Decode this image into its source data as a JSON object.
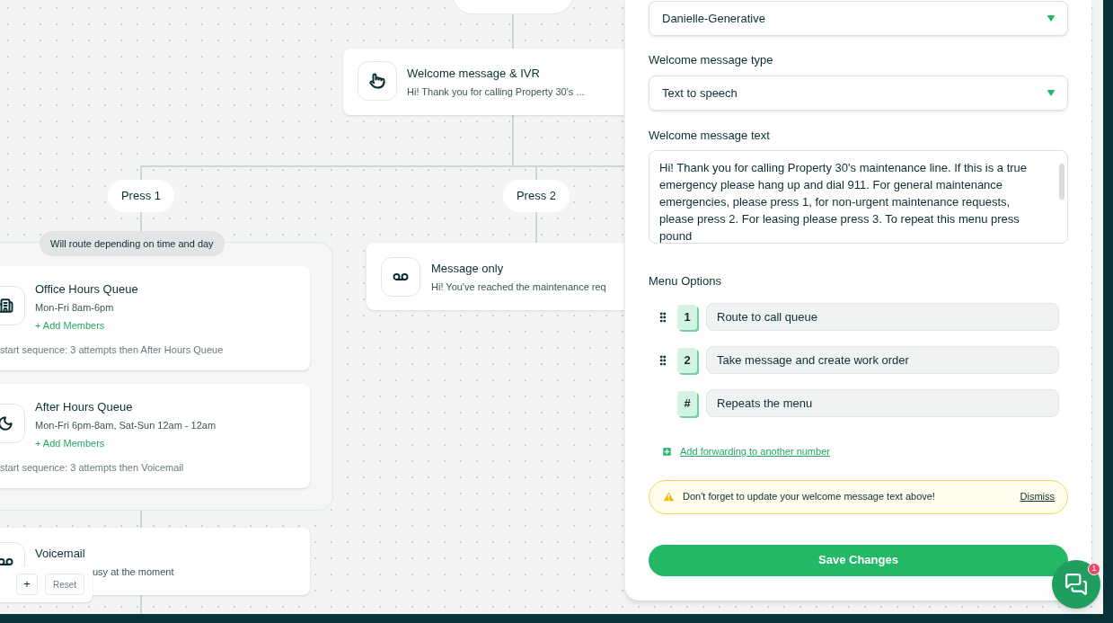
{
  "canvas": {
    "ivr_node": {
      "kind": "hand",
      "title": "Welcome message & IVR",
      "subtitle": "Hi! Thank you for calling Property 30's ..."
    },
    "branches": [
      {
        "label": "Press 1"
      },
      {
        "label": "Press 2"
      }
    ],
    "route_group": {
      "badge": "Will route depending on time and day",
      "queues": [
        {
          "kind": "building",
          "title": "Office Hours Queue",
          "hours": "Mon-Fri 8am-6pm",
          "action": "+ Add Members",
          "sequence": "start sequence: 3 attempts then After Hours Queue"
        },
        {
          "kind": "moon",
          "title": "After Hours Queue",
          "hours": "Mon-Fri 6pm-8am, Sat-Sun 12am - 12am",
          "action": "+ Add Members",
          "sequence": "start sequence: 3 attempts then Voicemail"
        }
      ]
    },
    "voicemail_node": {
      "kind": "voicemail",
      "title": "Voicemail",
      "subtitle": "usy at the moment"
    },
    "message_node": {
      "kind": "voicemail",
      "title": "Message only",
      "subtitle": "Hi! You've reached the maintenance req"
    },
    "zoom_controls": {
      "zoom_in": "+",
      "reset": "Reset"
    }
  },
  "panel": {
    "voice_select": {
      "value": "Danielle-Generative"
    },
    "type_select": {
      "label": "Welcome message type",
      "value": "Text to speech"
    },
    "text_field": {
      "label": "Welcome message text",
      "value": "Hi! Thank you for calling Property 30's maintenance line. If this is a true emergency please hang up and dial 911. For general maintenance emergencies, please press 1, for non-urgent maintenance requests, please press 2. For leasing please press 3. To repeat this menu press pound"
    },
    "menu_options": {
      "title": "Menu Options",
      "options": [
        {
          "key": "1",
          "label": "Route to call queue",
          "draggable": true
        },
        {
          "key": "2",
          "label": "Take message and create work order",
          "draggable": true
        },
        {
          "key": "#",
          "label": "Repeats the menu",
          "draggable": false
        }
      ]
    },
    "add_forwarding": "Add forwarding to another number",
    "alert": {
      "message": "Don't forget to update your welcome message text above!",
      "dismiss": "Dismiss"
    },
    "save_button": "Save Changes"
  },
  "chat": {
    "badge": "1"
  }
}
